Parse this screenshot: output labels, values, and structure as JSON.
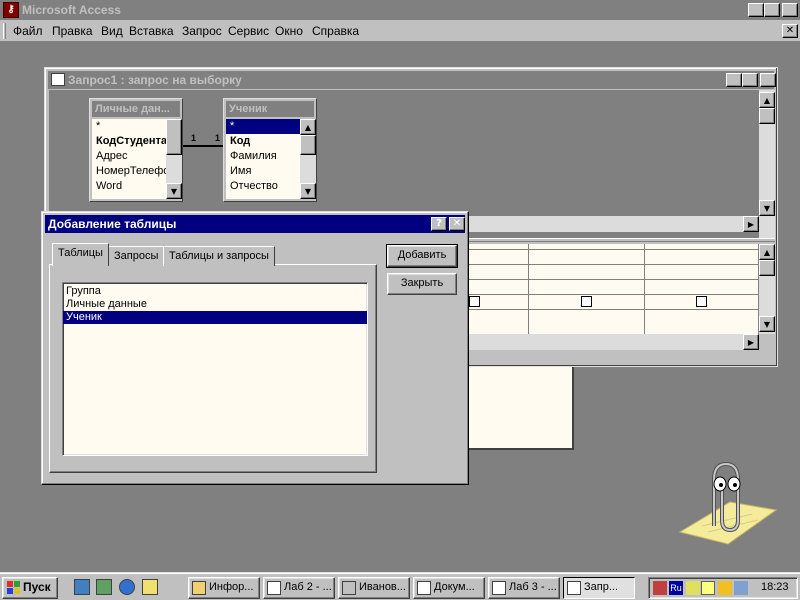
{
  "app": {
    "title": "Microsoft Access",
    "icon": "access-key-icon"
  },
  "menu": [
    "Файл",
    "Правка",
    "Вид",
    "Вставка",
    "Запрос",
    "Сервис",
    "Окно",
    "Справка"
  ],
  "query_window": {
    "title": "Запрос1 : запрос на выборку",
    "relation_left": "1",
    "relation_right": "1",
    "tables": [
      {
        "name": "Личные дан...",
        "fields": [
          "*",
          "КодСтудента",
          "Адрес",
          "НомерТелефо",
          "Word"
        ]
      },
      {
        "name": "Ученик",
        "fields": [
          "*",
          "Код",
          "Фамилия",
          "Имя",
          "Отчество"
        ]
      }
    ]
  },
  "dialog": {
    "title": "Добавление таблицы",
    "help": "?",
    "tabs": [
      "Таблицы",
      "Запросы",
      "Таблицы и запросы"
    ],
    "items": [
      "Группа",
      "Личные данные",
      "Ученик"
    ],
    "selected_item": "Ученик",
    "add_button": "Добавить",
    "close_button": "Закрыть"
  },
  "taskbar": {
    "start": "Пуск",
    "tasks": [
      "Инфор...",
      "Лаб 2 - ...",
      "Иванов...",
      "Докум...",
      "Лаб 3 - ...",
      "Запр..."
    ],
    "active_task": "Запр...",
    "tray_lang": "Ru",
    "clock": "18:23"
  }
}
